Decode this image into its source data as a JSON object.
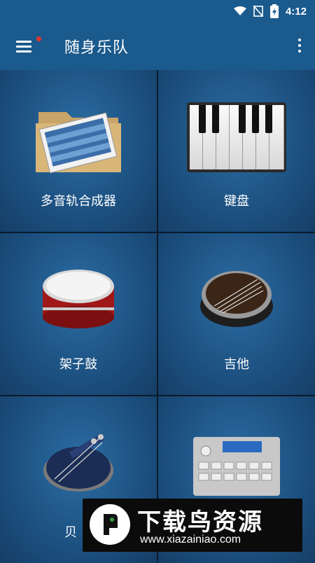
{
  "status_bar": {
    "time": "4:12",
    "icons": [
      "wifi-icon",
      "no-sim-icon",
      "battery-charging-icon"
    ]
  },
  "app_bar": {
    "title": "随身乐队",
    "menu_icon": "hamburger-menu-icon",
    "more_icon": "more-vert-icon",
    "has_notification_dot": true
  },
  "instruments": [
    {
      "label": "多音轨合成器",
      "icon": "multitrack-folder-icon"
    },
    {
      "label": "键盘",
      "icon": "piano-keyboard-icon"
    },
    {
      "label": "架子鼓",
      "icon": "drum-icon"
    },
    {
      "label": "吉他",
      "icon": "guitar-icon"
    },
    {
      "label": "贝",
      "icon": "bass-icon"
    },
    {
      "label": "",
      "icon": "drum-machine-icon"
    }
  ],
  "watermark": {
    "title": "下载鸟资源",
    "url": "www.xiazainiao.com"
  },
  "colors": {
    "appbar": "#1b5a8c",
    "tile": "#1d5283",
    "divider": "#0a1b2c",
    "notification": "#e5322d"
  }
}
